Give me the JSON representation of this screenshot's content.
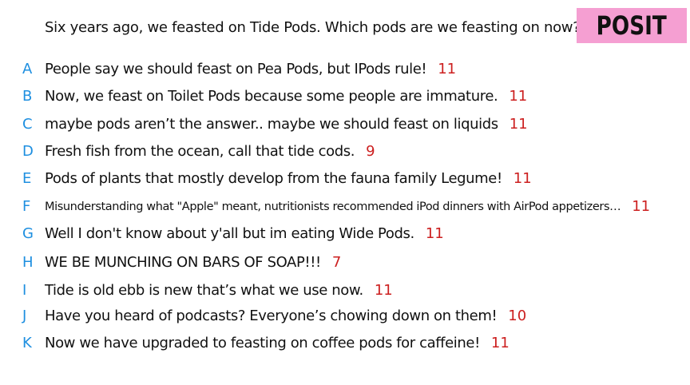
{
  "prompt": "Six years ago, we feasted on Tide Pods. Which pods are we feasting on now?",
  "badge": {
    "label": "POSIT",
    "color": "#f59fd2"
  },
  "colors": {
    "letter": "#1e8fe0",
    "score": "#cc1f1f",
    "text": "#111111"
  },
  "answers": [
    {
      "letter": "A",
      "text": "People say we should feast on Pea Pods, but IPods rule!",
      "score": "11"
    },
    {
      "letter": "B",
      "text": "Now, we feast on Toilet Pods because some people are immature.",
      "score": "11"
    },
    {
      "letter": "C",
      "text": "maybe pods aren’t the answer.. maybe we should feast on liquids",
      "score": "11"
    },
    {
      "letter": "D",
      "text": "Fresh fish from the ocean, call that tide cods.",
      "score": "9"
    },
    {
      "letter": "E",
      "text": "Pods of plants that mostly develop from the fauna family Legume!",
      "score": "11"
    },
    {
      "letter": "F",
      "text": "Misunderstanding what \"Apple\" meant, nutritionists recommended iPod dinners with AirPod appetizers…",
      "score": "11"
    },
    {
      "letter": "G",
      "text": "Well I don't know about y'all but im eating Wide Pods.",
      "score": "11"
    },
    {
      "letter": "H",
      "text": "WE BE MUNCHING ON BARS OF SOAP!!!",
      "score": "7"
    },
    {
      "letter": "I",
      "text": "Tide is old ebb is new that’s what we use now.",
      "score": "11"
    },
    {
      "letter": "J",
      "text": "Have you heard of podcasts? Everyone’s chowing down on them!",
      "score": "10"
    },
    {
      "letter": "K",
      "text": "Now we have upgraded to feasting on coffee pods for caffeine!",
      "score": "11"
    }
  ]
}
